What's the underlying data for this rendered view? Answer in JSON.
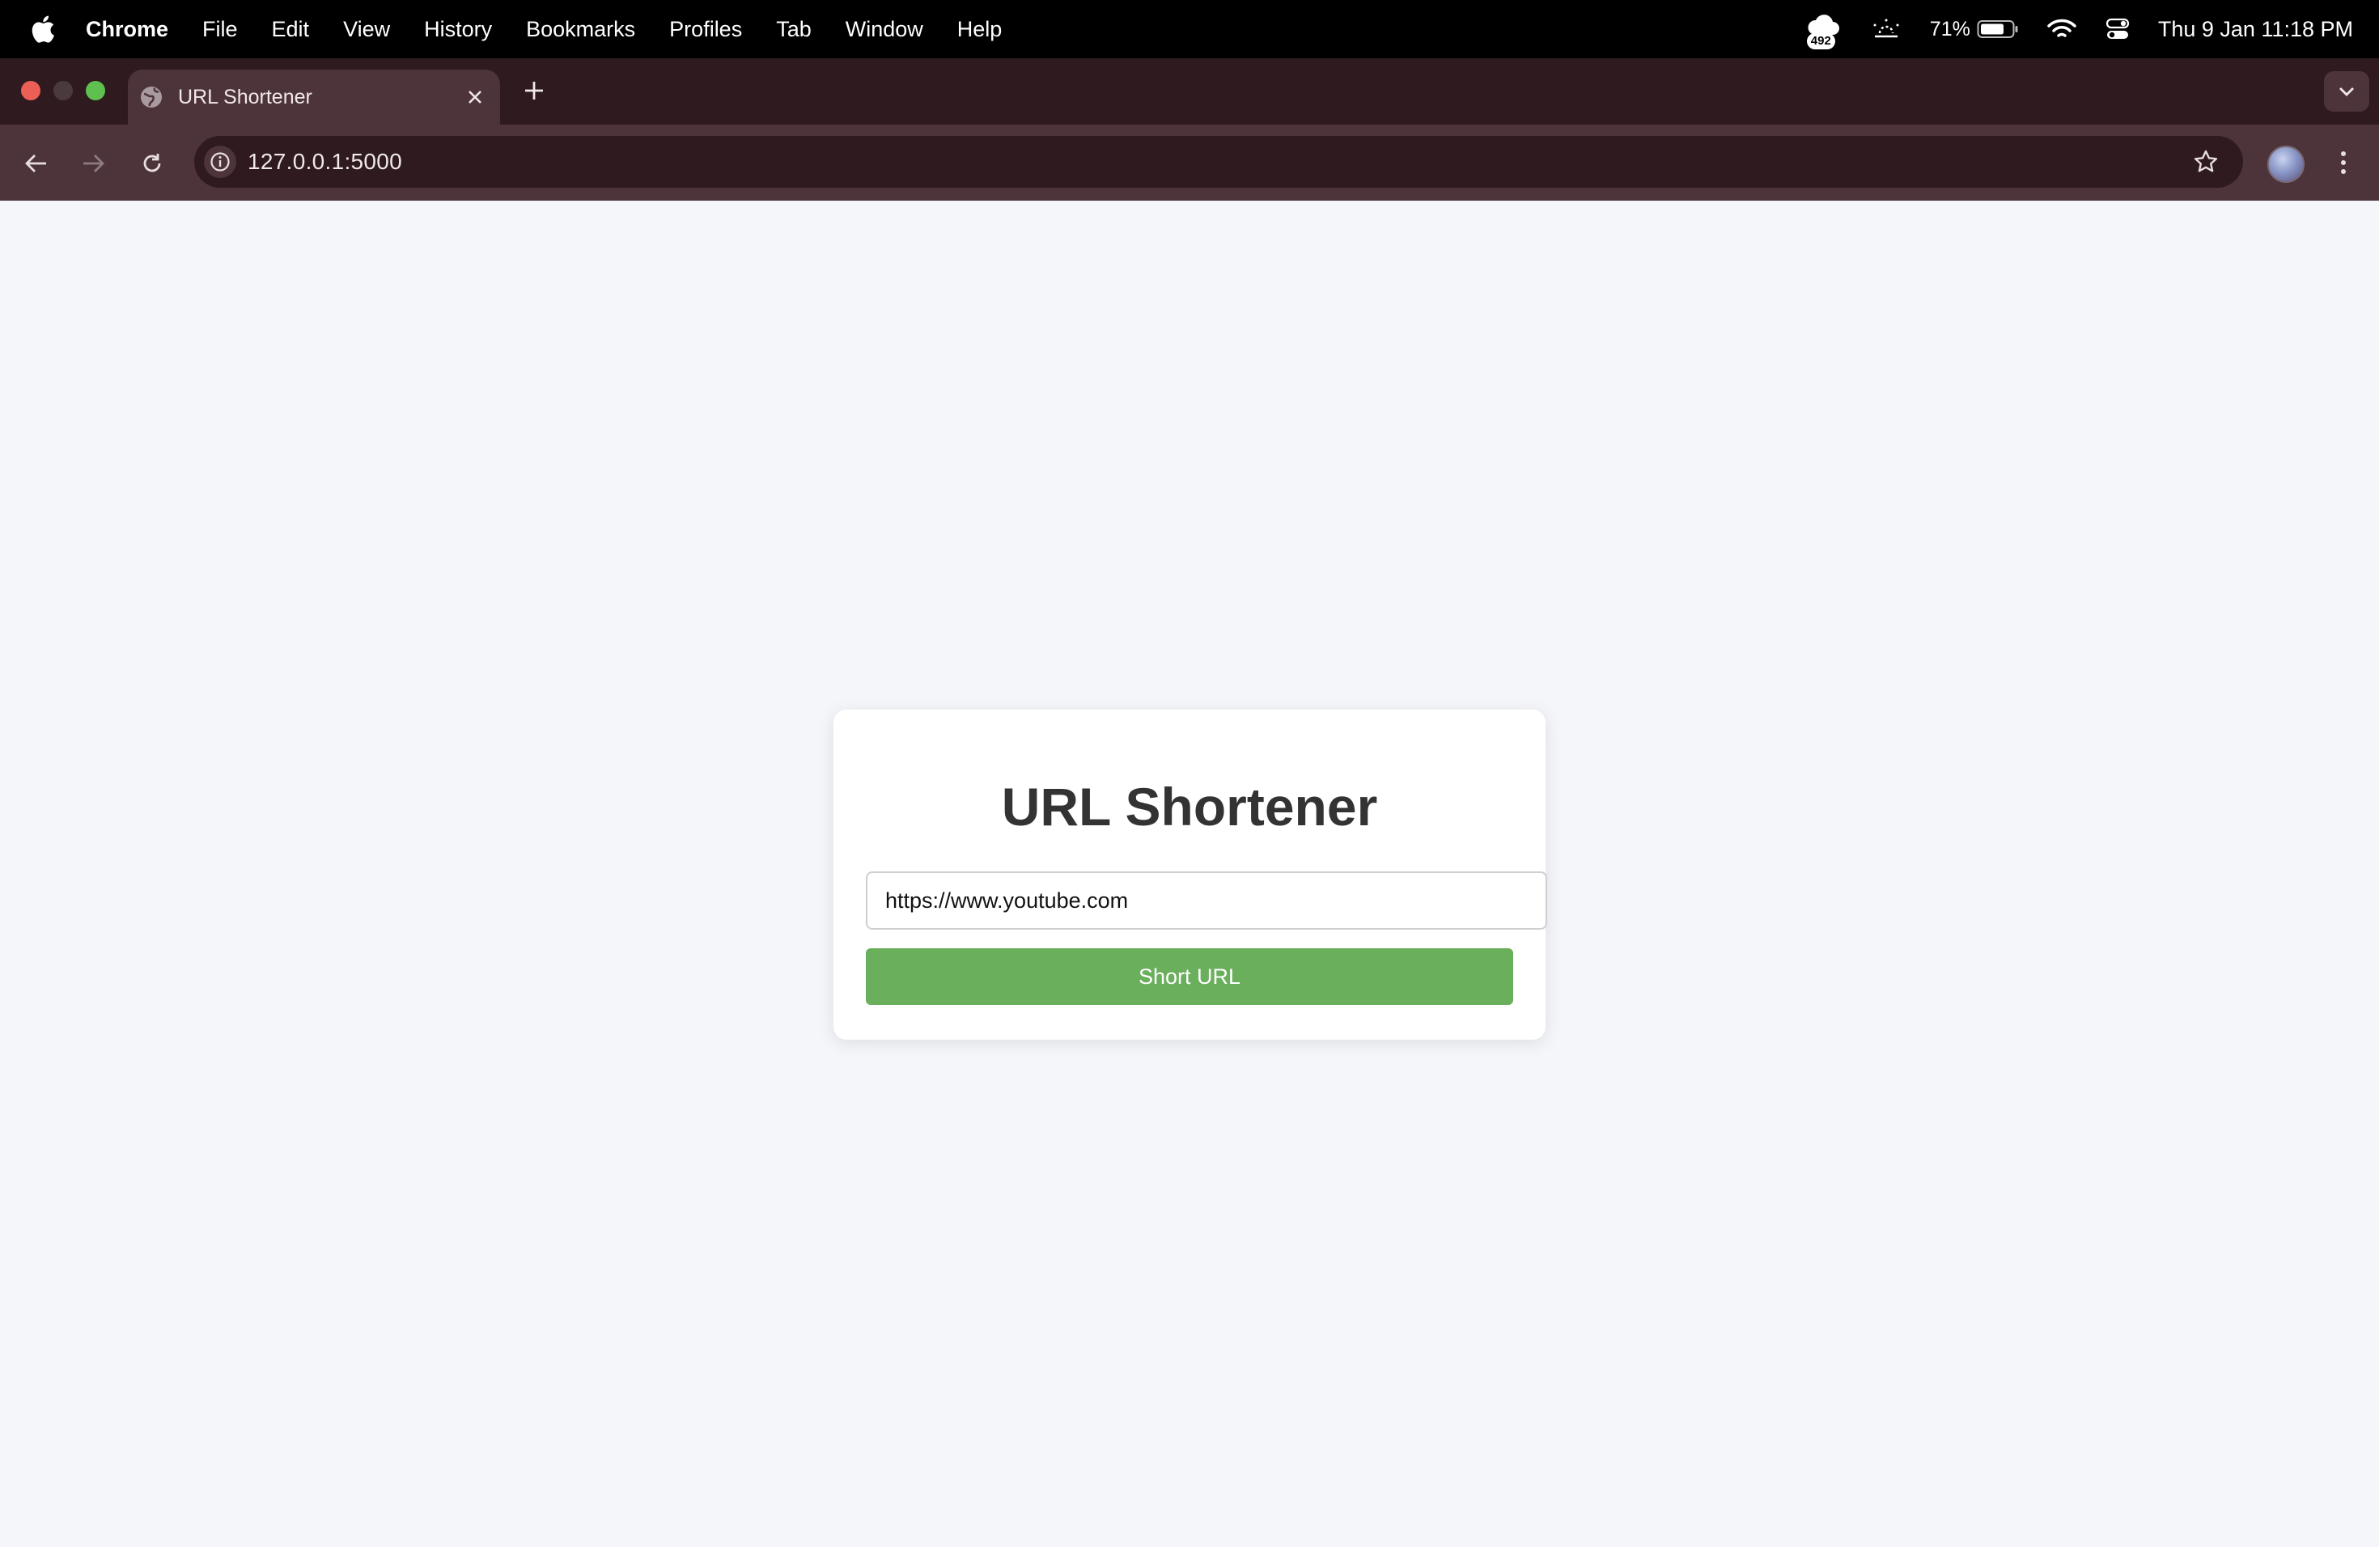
{
  "menubar": {
    "app_name": "Chrome",
    "items": [
      "File",
      "Edit",
      "View",
      "History",
      "Bookmarks",
      "Profiles",
      "Tab",
      "Window",
      "Help"
    ],
    "status": {
      "notification_count": "492",
      "battery_percent": "71%",
      "clock": "Thu 9 Jan  11:18 PM"
    }
  },
  "browser": {
    "tab": {
      "title": "URL Shortener",
      "favicon": "globe-icon"
    },
    "address": "127.0.0.1:5000"
  },
  "page": {
    "heading": "URL Shortener",
    "input_value": "https://www.youtube.com",
    "button_label": "Short URL"
  },
  "colors": {
    "page_bg": "#f5f6fa",
    "button_bg": "#6aaf5c",
    "chrome_frame": "#2e1a1f",
    "chrome_toolbar": "#4d343a"
  }
}
